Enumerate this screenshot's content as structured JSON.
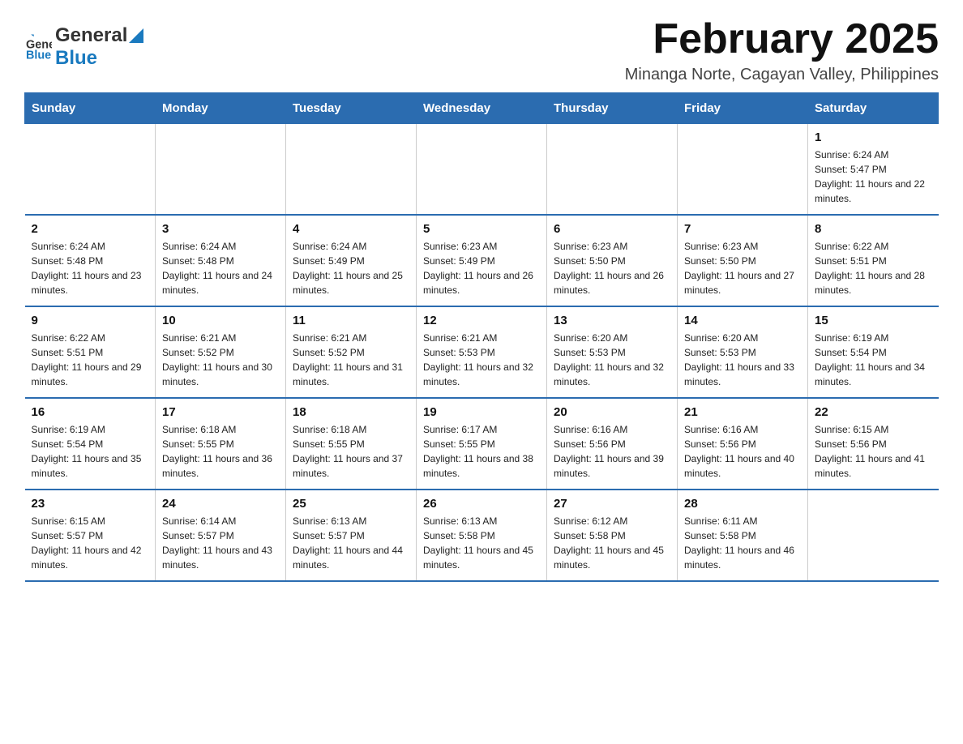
{
  "header": {
    "logo_text_general": "General",
    "logo_text_blue": "Blue",
    "month_title": "February 2025",
    "location": "Minanga Norte, Cagayan Valley, Philippines"
  },
  "days_of_week": [
    "Sunday",
    "Monday",
    "Tuesday",
    "Wednesday",
    "Thursday",
    "Friday",
    "Saturday"
  ],
  "weeks": [
    [
      {
        "day": "",
        "info": ""
      },
      {
        "day": "",
        "info": ""
      },
      {
        "day": "",
        "info": ""
      },
      {
        "day": "",
        "info": ""
      },
      {
        "day": "",
        "info": ""
      },
      {
        "day": "",
        "info": ""
      },
      {
        "day": "1",
        "info": "Sunrise: 6:24 AM\nSunset: 5:47 PM\nDaylight: 11 hours and 22 minutes."
      }
    ],
    [
      {
        "day": "2",
        "info": "Sunrise: 6:24 AM\nSunset: 5:48 PM\nDaylight: 11 hours and 23 minutes."
      },
      {
        "day": "3",
        "info": "Sunrise: 6:24 AM\nSunset: 5:48 PM\nDaylight: 11 hours and 24 minutes."
      },
      {
        "day": "4",
        "info": "Sunrise: 6:24 AM\nSunset: 5:49 PM\nDaylight: 11 hours and 25 minutes."
      },
      {
        "day": "5",
        "info": "Sunrise: 6:23 AM\nSunset: 5:49 PM\nDaylight: 11 hours and 26 minutes."
      },
      {
        "day": "6",
        "info": "Sunrise: 6:23 AM\nSunset: 5:50 PM\nDaylight: 11 hours and 26 minutes."
      },
      {
        "day": "7",
        "info": "Sunrise: 6:23 AM\nSunset: 5:50 PM\nDaylight: 11 hours and 27 minutes."
      },
      {
        "day": "8",
        "info": "Sunrise: 6:22 AM\nSunset: 5:51 PM\nDaylight: 11 hours and 28 minutes."
      }
    ],
    [
      {
        "day": "9",
        "info": "Sunrise: 6:22 AM\nSunset: 5:51 PM\nDaylight: 11 hours and 29 minutes."
      },
      {
        "day": "10",
        "info": "Sunrise: 6:21 AM\nSunset: 5:52 PM\nDaylight: 11 hours and 30 minutes."
      },
      {
        "day": "11",
        "info": "Sunrise: 6:21 AM\nSunset: 5:52 PM\nDaylight: 11 hours and 31 minutes."
      },
      {
        "day": "12",
        "info": "Sunrise: 6:21 AM\nSunset: 5:53 PM\nDaylight: 11 hours and 32 minutes."
      },
      {
        "day": "13",
        "info": "Sunrise: 6:20 AM\nSunset: 5:53 PM\nDaylight: 11 hours and 32 minutes."
      },
      {
        "day": "14",
        "info": "Sunrise: 6:20 AM\nSunset: 5:53 PM\nDaylight: 11 hours and 33 minutes."
      },
      {
        "day": "15",
        "info": "Sunrise: 6:19 AM\nSunset: 5:54 PM\nDaylight: 11 hours and 34 minutes."
      }
    ],
    [
      {
        "day": "16",
        "info": "Sunrise: 6:19 AM\nSunset: 5:54 PM\nDaylight: 11 hours and 35 minutes."
      },
      {
        "day": "17",
        "info": "Sunrise: 6:18 AM\nSunset: 5:55 PM\nDaylight: 11 hours and 36 minutes."
      },
      {
        "day": "18",
        "info": "Sunrise: 6:18 AM\nSunset: 5:55 PM\nDaylight: 11 hours and 37 minutes."
      },
      {
        "day": "19",
        "info": "Sunrise: 6:17 AM\nSunset: 5:55 PM\nDaylight: 11 hours and 38 minutes."
      },
      {
        "day": "20",
        "info": "Sunrise: 6:16 AM\nSunset: 5:56 PM\nDaylight: 11 hours and 39 minutes."
      },
      {
        "day": "21",
        "info": "Sunrise: 6:16 AM\nSunset: 5:56 PM\nDaylight: 11 hours and 40 minutes."
      },
      {
        "day": "22",
        "info": "Sunrise: 6:15 AM\nSunset: 5:56 PM\nDaylight: 11 hours and 41 minutes."
      }
    ],
    [
      {
        "day": "23",
        "info": "Sunrise: 6:15 AM\nSunset: 5:57 PM\nDaylight: 11 hours and 42 minutes."
      },
      {
        "day": "24",
        "info": "Sunrise: 6:14 AM\nSunset: 5:57 PM\nDaylight: 11 hours and 43 minutes."
      },
      {
        "day": "25",
        "info": "Sunrise: 6:13 AM\nSunset: 5:57 PM\nDaylight: 11 hours and 44 minutes."
      },
      {
        "day": "26",
        "info": "Sunrise: 6:13 AM\nSunset: 5:58 PM\nDaylight: 11 hours and 45 minutes."
      },
      {
        "day": "27",
        "info": "Sunrise: 6:12 AM\nSunset: 5:58 PM\nDaylight: 11 hours and 45 minutes."
      },
      {
        "day": "28",
        "info": "Sunrise: 6:11 AM\nSunset: 5:58 PM\nDaylight: 11 hours and 46 minutes."
      },
      {
        "day": "",
        "info": ""
      }
    ]
  ]
}
